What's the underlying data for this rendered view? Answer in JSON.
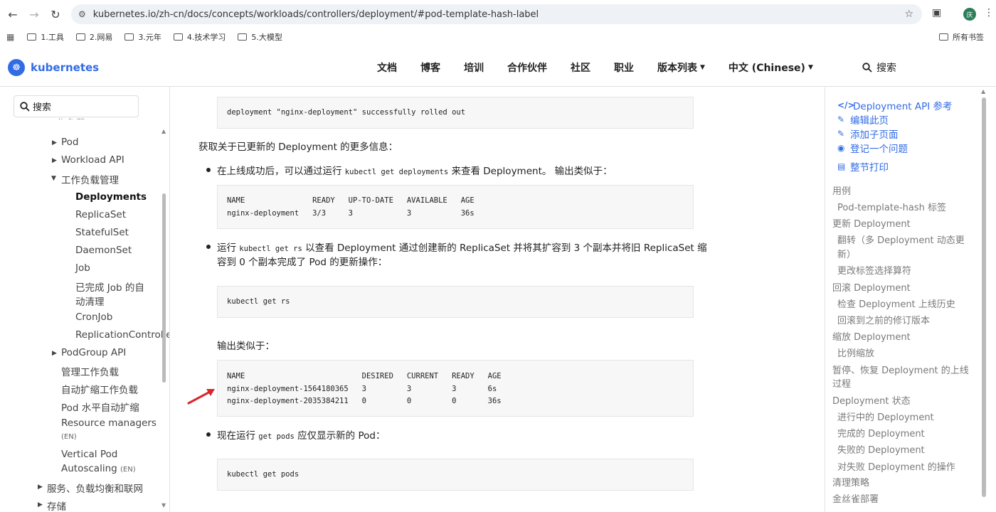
{
  "browser": {
    "url": "kubernetes.io/zh-cn/docs/concepts/workloads/controllers/deployment/#pod-template-hash-label",
    "avatar_text": "庆",
    "bookmarks": [
      "1.工具",
      "2.网易",
      "3.元年",
      "4.技术学习",
      "5.大模型"
    ],
    "all_bookmarks": "所有书签"
  },
  "header": {
    "logo_text": "kubernetes",
    "nav": [
      "文档",
      "博客",
      "培训",
      "合作伙伴",
      "社区",
      "职业",
      "版本列表",
      "中文 (Chinese)"
    ],
    "search_label": "搜索"
  },
  "sidebar": {
    "search_label": "搜索",
    "partial_top": "工作负载",
    "items": [
      "Pod",
      "Workload API",
      "工作负载管理",
      "Deployments",
      "ReplicaSet",
      "StatefulSet",
      "DaemonSet",
      "Job",
      "已完成 Job 的自",
      "动清理",
      "CronJob",
      "ReplicationControlle",
      "PodGroup API",
      "管理工作负载",
      "自动扩缩工作负载",
      "Pod 水平自动扩缩",
      "Resource managers",
      "(EN)",
      "Vertical Pod",
      "Autoscaling",
      "(EN)",
      "服务、负载均衡和联网",
      "存储"
    ]
  },
  "main": {
    "code1": "deployment \"nginx-deployment\" successfully rolled out",
    "p1": "获取关于已更新的 Deployment 的更多信息：",
    "b1_pre": "在上线成功后，可以通过运行 ",
    "b1_code": "kubectl get deployments",
    "b1_post": " 来查看 Deployment。 输出类似于：",
    "code2": "NAME               READY   UP-TO-DATE   AVAILABLE   AGE\nnginx-deployment   3/3     3            3           36s",
    "b2_pre": "运行 ",
    "b2_code": "kubectl get rs",
    "b2_post": " 以查看 Deployment 通过创建新的 ReplicaSet 并将其扩容到 3 个副本并将旧 ReplicaSet 缩",
    "b2_line2": "容到 0 个副本完成了 Pod 的更新操作：",
    "code3": "kubectl get rs",
    "p2": "输出类似于：",
    "code4": "NAME                          DESIRED   CURRENT   READY   AGE\nnginx-deployment-1564180365   3         3         3       6s\nnginx-deployment-2035384211   0         0         0       36s",
    "b3_pre": "现在运行 ",
    "b3_code": "get pods",
    "b3_post": " 应仅显示新的 Pod：",
    "code5": "kubectl get pods"
  },
  "toc": {
    "links": [
      "Deployment API 参考",
      "编辑此页",
      "添加子页面",
      "登记一个问题",
      "整节打印"
    ],
    "items": [
      "用例",
      "Pod-template-hash 标签",
      "更新 Deployment",
      "翻转（多 Deployment 动态更",
      "新）",
      "更改标签选择算符",
      "回滚 Deployment",
      "检查 Deployment 上线历史",
      "回滚到之前的修订版本",
      "缩放 Deployment",
      "比例缩放",
      "暂停、恢复 Deployment 的上线",
      "过程",
      "Deployment 状态",
      "进行中的 Deployment",
      "完成的 Deployment",
      "失败的 Deployment",
      "对失败 Deployment 的操作",
      "清理策略",
      "金丝雀部署"
    ]
  },
  "colors": {
    "accent": "#326ce5",
    "arrow": "#d9262c"
  }
}
